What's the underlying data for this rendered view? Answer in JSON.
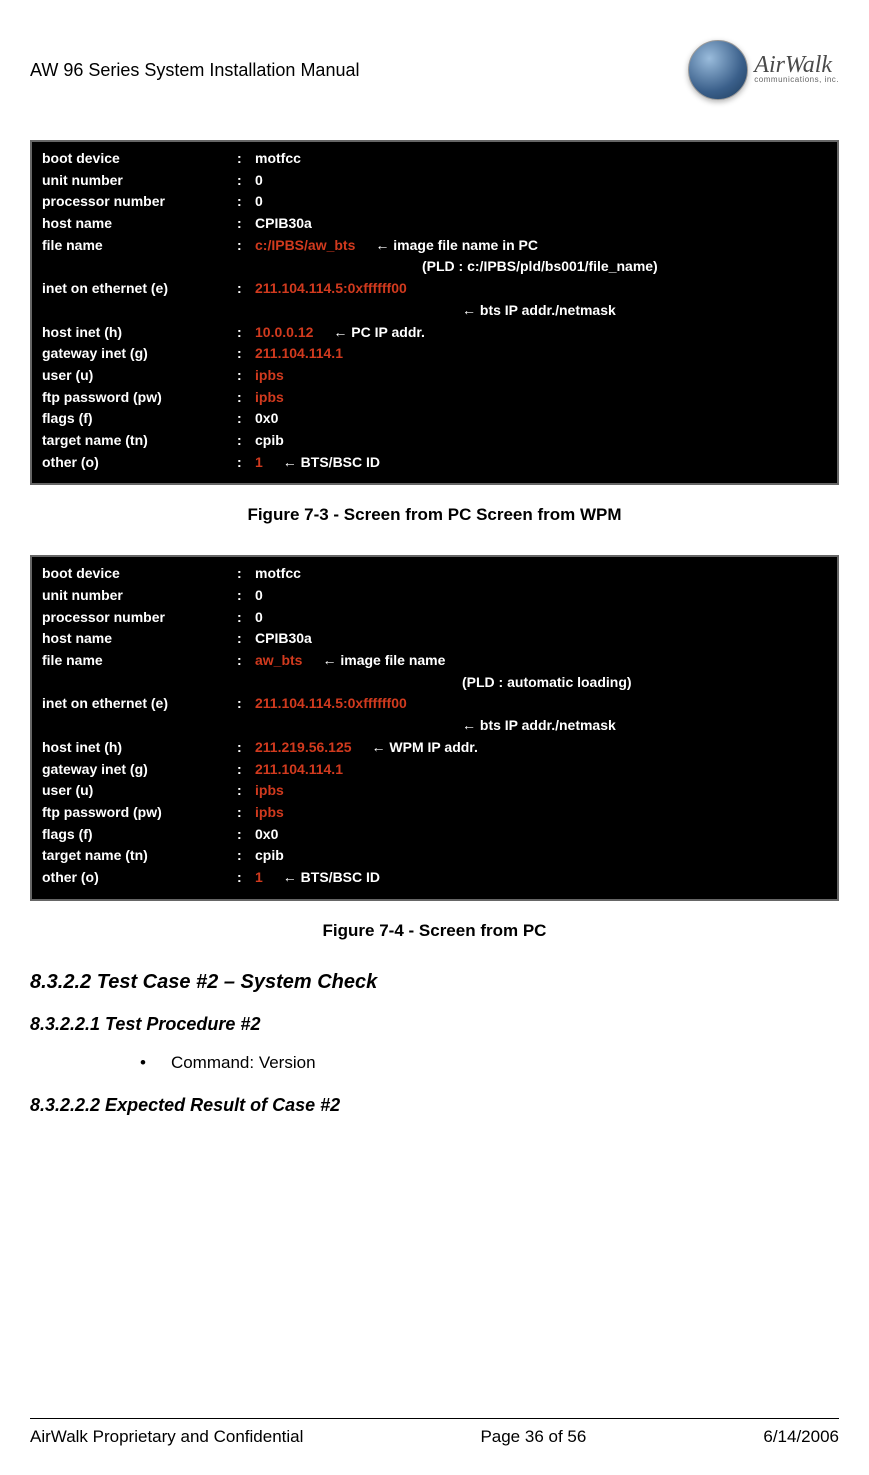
{
  "header": {
    "title": "AW 96 Series System Installation Manual",
    "logo_text": "AirWalk",
    "logo_sub": "communications, inc."
  },
  "terminal1": {
    "rows": [
      {
        "label": "boot device",
        "value": "motfcc",
        "red": false,
        "note": ""
      },
      {
        "label": "unit number",
        "value": "0",
        "red": false,
        "note": ""
      },
      {
        "label": "processor number",
        "value": "0",
        "red": false,
        "note": ""
      },
      {
        "label": "host name",
        "value": "CPIB30a",
        "red": false,
        "note": ""
      },
      {
        "label": "file name",
        "value": "c:/IPBS/aw_bts",
        "red": true,
        "note": "← image file name in PC"
      },
      {
        "label": "",
        "value": "",
        "red": false,
        "note": "(PLD : c:/IPBS/pld/bs001/file_name)",
        "indent": true
      },
      {
        "label": "inet on ethernet (e)",
        "value": "211.104.114.5:0xffffff00",
        "red": true,
        "note": ""
      },
      {
        "label": "",
        "value": "",
        "red": false,
        "note": "← bts IP addr./netmask",
        "indent2": true
      },
      {
        "label": "host inet (h)",
        "value": "10.0.0.12",
        "red": true,
        "note": "← PC IP addr."
      },
      {
        "label": "gateway inet (g)",
        "value": "211.104.114.1",
        "red": true,
        "note": ""
      },
      {
        "label": "user (u)",
        "value": "ipbs",
        "red": true,
        "note": ""
      },
      {
        "label": "ftp password (pw)",
        "value": "ipbs",
        "red": true,
        "note": ""
      },
      {
        "label": "flags (f)",
        "value": "0x0",
        "red": false,
        "note": ""
      },
      {
        "label": "target name (tn)",
        "value": "cpib",
        "red": false,
        "note": ""
      },
      {
        "label": "other (o)",
        "value": "1",
        "red": true,
        "note": "← BTS/BSC ID"
      }
    ]
  },
  "caption1": "Figure 7-3 - Screen from PC Screen from WPM",
  "terminal2": {
    "rows": [
      {
        "label": "boot device",
        "value": "motfcc",
        "red": false,
        "note": ""
      },
      {
        "label": "unit number",
        "value": "0",
        "red": false,
        "note": ""
      },
      {
        "label": "processor number",
        "value": "0",
        "red": false,
        "note": ""
      },
      {
        "label": "host name",
        "value": "CPIB30a",
        "red": false,
        "note": ""
      },
      {
        "label": "file name",
        "value": "aw_bts",
        "red": true,
        "note": "← image file name"
      },
      {
        "label": "",
        "value": "",
        "red": false,
        "note": "(PLD : automatic loading)",
        "indent2": true
      },
      {
        "label": "inet on ethernet (e)",
        "value": "211.104.114.5:0xffffff00",
        "red": true,
        "note": ""
      },
      {
        "label": "",
        "value": "",
        "red": false,
        "note": "← bts IP addr./netmask",
        "indent2": true
      },
      {
        "label": "host inet (h)",
        "value": "211.219.56.125",
        "red": true,
        "note": "← WPM IP addr."
      },
      {
        "label": "gateway inet (g)",
        "value": "211.104.114.1",
        "red": true,
        "note": ""
      },
      {
        "label": "user (u)",
        "value": "ipbs",
        "red": true,
        "note": ""
      },
      {
        "label": "ftp password (pw)",
        "value": "ipbs",
        "red": true,
        "note": ""
      },
      {
        "label": "flags (f)",
        "value": "0x0",
        "red": false,
        "note": ""
      },
      {
        "label": "target name (tn)",
        "value": "cpib",
        "red": false,
        "note": ""
      },
      {
        "label": "other (o)",
        "value": "1",
        "red": true,
        "note": "← BTS/BSC ID"
      }
    ]
  },
  "caption2": "Figure 7-4 - Screen from PC",
  "sections": {
    "s1": "8.3.2.2  Test Case #2 – System Check",
    "s2": "8.3.2.2.1  Test Procedure #2",
    "bullet": "Command: Version",
    "s3": "8.3.2.2.2  Expected Result of Case #2"
  },
  "footer": {
    "left": "AirWalk Proprietary and Confidential",
    "center": "Page 36 of 56",
    "right": "6/14/2006"
  }
}
